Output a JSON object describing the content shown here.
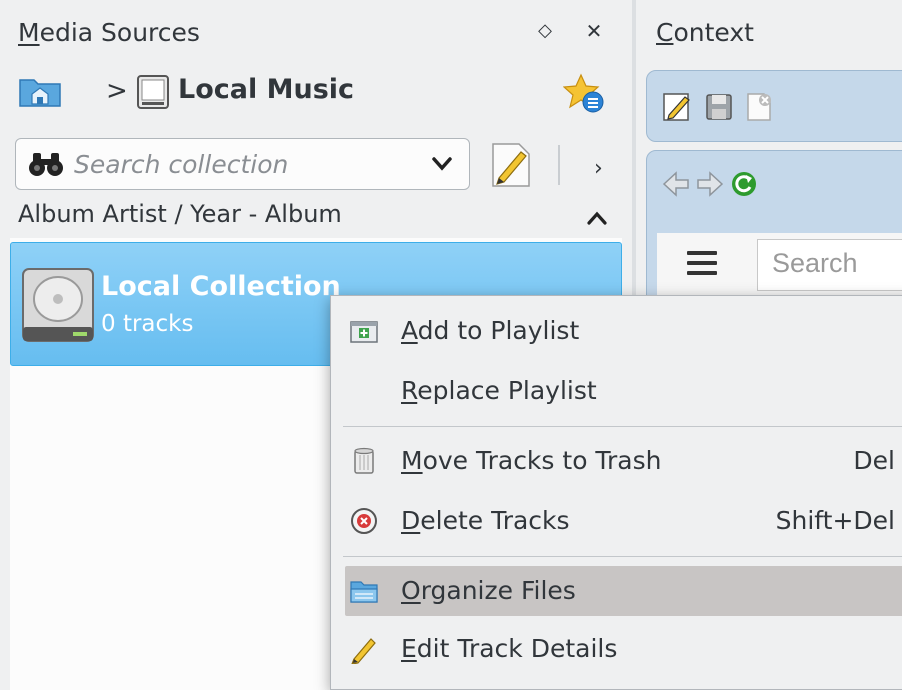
{
  "media_sources": {
    "title_prefix": "M",
    "title_rest": "edia Sources",
    "float_glyph": "◇",
    "close_glyph": "✕",
    "breadcrumb_separator": ">",
    "breadcrumb_label": "Local Music",
    "search": {
      "placeholder": "Search collection",
      "value": ""
    },
    "more_glyph": "›",
    "sort_label": "Album Artist / Year - Album",
    "collection": {
      "name": "Local Collection",
      "track_count": "0 tracks"
    }
  },
  "context_pane": {
    "title_prefix": "C",
    "title_rest": "ontext",
    "web_search_placeholder": "Search"
  },
  "context_menu": {
    "items": [
      {
        "mnemonic": "A",
        "label_rest": "dd to Playlist",
        "shortcut": ""
      },
      {
        "mnemonic": "R",
        "label_rest": "eplace Playlist",
        "shortcut": ""
      },
      {
        "mnemonic": "M",
        "label_rest": "ove Tracks to Trash",
        "shortcut": "Del"
      },
      {
        "mnemonic": "D",
        "label_rest": "elete Tracks",
        "shortcut": "Shift+Del"
      },
      {
        "mnemonic": "O",
        "label_rest": "rganize Files",
        "shortcut": ""
      },
      {
        "mnemonic": "E",
        "label_rest": "dit Track Details",
        "shortcut": ""
      }
    ]
  },
  "colors": {
    "selection": "#66bdf0",
    "menu_highlight": "#c8c5c4",
    "panel_background": "#eff0f1",
    "context_toolbar": "#c5d8ea"
  }
}
